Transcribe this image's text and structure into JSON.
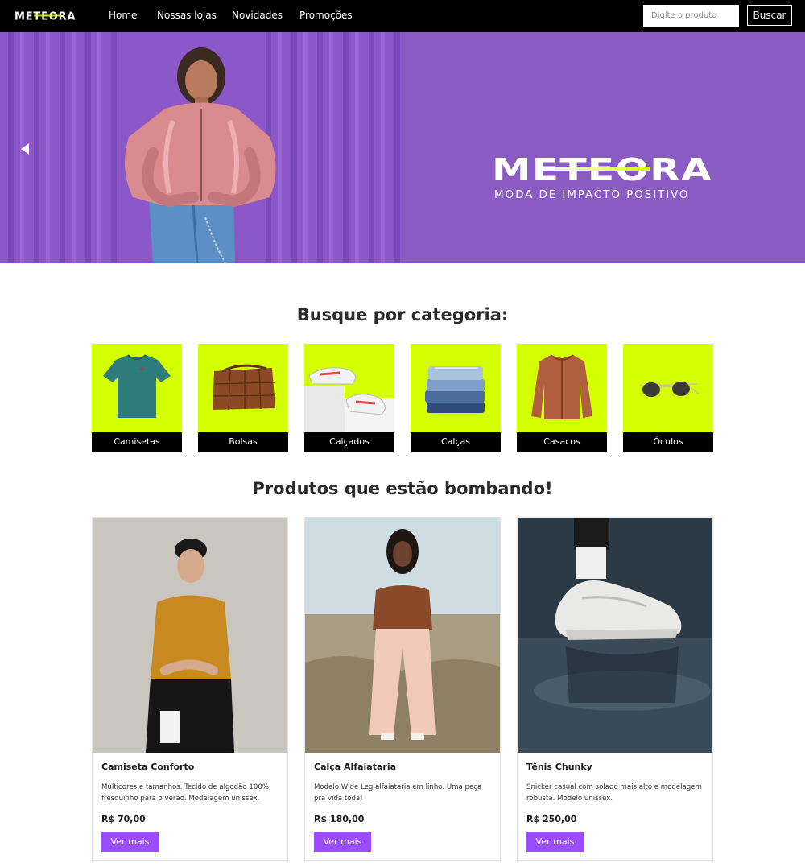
{
  "navbar": {
    "logo_text": "METEORA",
    "links": [
      {
        "label": "Home"
      },
      {
        "label": "Nossas lojas"
      },
      {
        "label": "Novidades"
      },
      {
        "label": "Promoções"
      }
    ],
    "search": {
      "placeholder": "Digite o produto",
      "value": ""
    },
    "search_button": "Buscar"
  },
  "hero": {
    "logo_text": "METEORA",
    "tagline": "MODA DE IMPACTO POSITIVO",
    "background_color": "#8a5bc2",
    "prev_icon": "triangle-left-icon"
  },
  "categories": {
    "title": "Busque por categoria:",
    "accent_color": "#d4ff00",
    "items": [
      {
        "label": "Camisetas",
        "icon": "tshirt-icon"
      },
      {
        "label": "Bolsas",
        "icon": "bag-icon"
      },
      {
        "label": "Calçados",
        "icon": "sneaker-icon"
      },
      {
        "label": "Calças",
        "icon": "jeans-icon"
      },
      {
        "label": "Casacos",
        "icon": "jacket-icon"
      },
      {
        "label": "Óculos",
        "icon": "sunglasses-icon"
      }
    ]
  },
  "products": {
    "title": "Produtos que estão bombando!",
    "button_color": "#9b4dff",
    "items": [
      {
        "name": "Camiseta Conforto",
        "description": "Multicores e tamanhos. Tecido de algodão 100%, fresquinho para o verão. Modelagem unissex.",
        "price": "R$ 70,00",
        "button": "Ver mais"
      },
      {
        "name": "Calça Alfaiataria",
        "description": "Modelo Wide Leg alfaiataria em linho. Uma peça pra vida toda!",
        "price": "R$ 180,00",
        "button": "Ver mais"
      },
      {
        "name": "Tênis Chunky",
        "description": "Snicker casual com solado mais alto e modelagem robusta. Modelo unissex.",
        "price": "R$ 250,00",
        "button": "Ver mais"
      }
    ]
  }
}
